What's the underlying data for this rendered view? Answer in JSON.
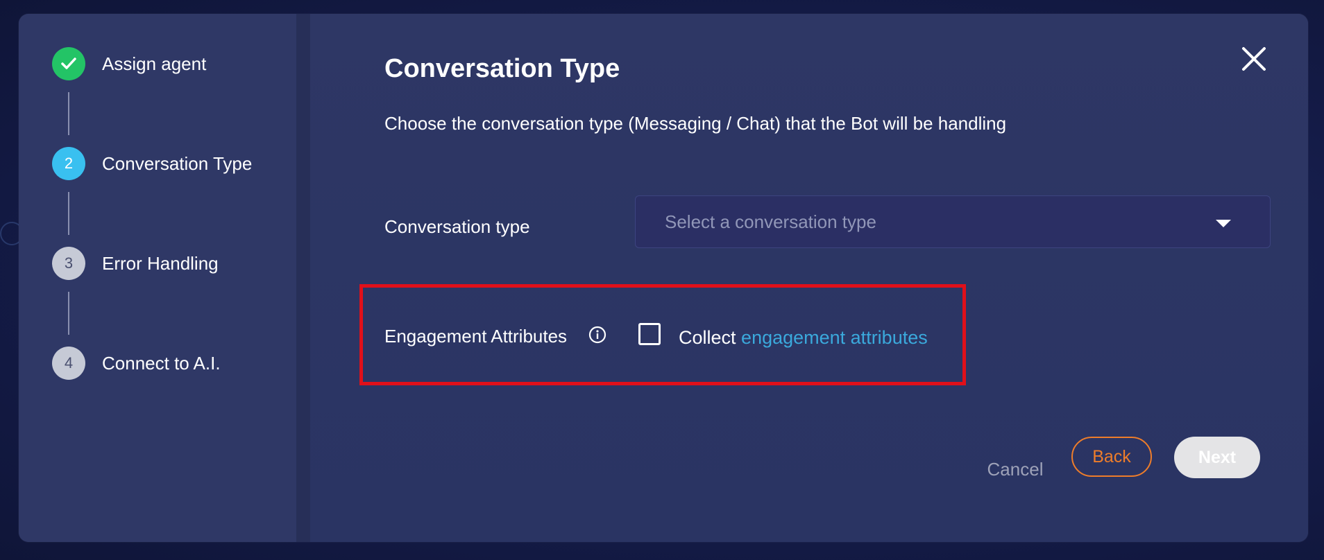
{
  "stepper": {
    "steps": [
      {
        "number": "",
        "label": "Assign agent",
        "status": "done",
        "icon": "check-icon"
      },
      {
        "number": "2",
        "label": "Conversation Type",
        "status": "active"
      },
      {
        "number": "3",
        "label": "Error Handling",
        "status": "pending"
      },
      {
        "number": "4",
        "label": "Connect to A.I.",
        "status": "pending"
      }
    ]
  },
  "main": {
    "title": "Conversation Type",
    "subtitle": "Choose the conversation type (Messaging / Chat) that the Bot will be handling",
    "close_icon": "close-icon",
    "conversation_type": {
      "label": "Conversation type",
      "placeholder": "Select a conversation type"
    },
    "engagement": {
      "label": "Engagement Attributes",
      "info_icon": "info-icon",
      "checked": false,
      "collect_text": "Collect",
      "link_text": "engagement attributes"
    }
  },
  "footer": {
    "cancel_label": "Cancel",
    "back_label": "Back",
    "next_label": "Next"
  },
  "colors": {
    "accent_orange": "#ee7d2a",
    "active_step": "#39c0f0",
    "done_step": "#23c466",
    "link": "#3ba9dc",
    "highlight": "#e0101a"
  }
}
